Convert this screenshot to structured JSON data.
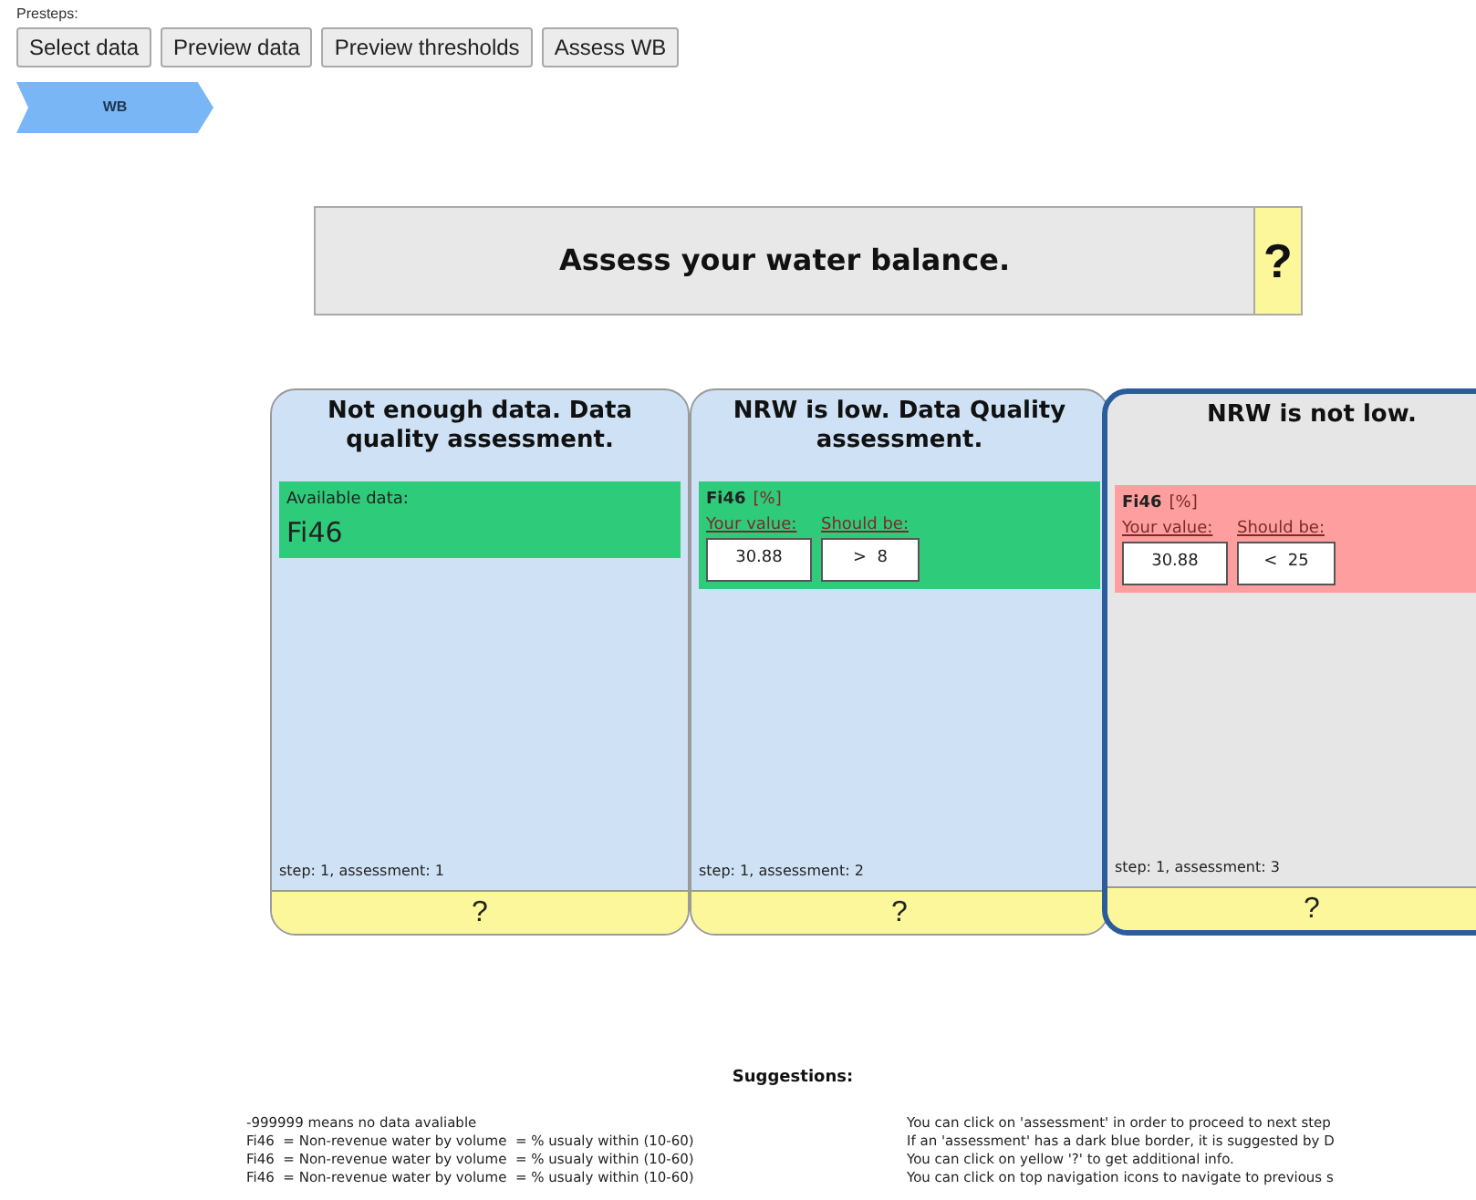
{
  "presteps": {
    "label": "Presteps:",
    "buttons": [
      "Select data",
      "Preview data",
      "Preview thresholds",
      "Assess WB"
    ]
  },
  "breadcrumb": [
    {
      "label": "WB",
      "selected": true
    }
  ],
  "header": {
    "title": "Assess your water balance.",
    "help": "?"
  },
  "cards": [
    {
      "title": "Not enough data. Data quality assessment.",
      "selected": false,
      "kind": "available",
      "color": "#2ecc7a",
      "label": "Available data:",
      "value": "Fi46",
      "step": "step: 1, assessment: 1",
      "help": "?"
    },
    {
      "title": "NRW is low. Data Quality assessment.",
      "selected": false,
      "kind": "threshold",
      "color": "#2ecc7a",
      "indicator": "Fi46",
      "unit": "[%]",
      "your_label": "Your value:",
      "your_value": "30.88",
      "should_label": "Should be:",
      "should_value": ">  8",
      "step": "step: 1, assessment: 2",
      "help": "?"
    },
    {
      "title": "NRW is not low.",
      "selected": true,
      "kind": "threshold",
      "color": "#ff9e9e",
      "indicator": "Fi46",
      "unit": "[%]",
      "your_label": "Your value:",
      "your_value": "30.88",
      "should_label": "Should be:",
      "should_value": "<  25",
      "step": "step: 1, assessment: 3",
      "help": "?"
    }
  ],
  "suggestions": {
    "title": "Suggestions:",
    "left": [
      "-999999 means no data avaliable",
      "Fi46  = Non-revenue water by volume  = % usualy within (10-60)",
      "Fi46  = Non-revenue water by volume  = % usualy within (10-60)",
      "Fi46  = Non-revenue water by volume  = % usualy within (10-60)"
    ],
    "right": [
      "You can click on 'assessment' in order to proceed to next step",
      "If an 'assessment' has a dark blue border, it is suggested by D",
      "You can click on yellow '?' to get additional info.",
      "You can click on top navigation icons to navigate to previous s"
    ]
  }
}
